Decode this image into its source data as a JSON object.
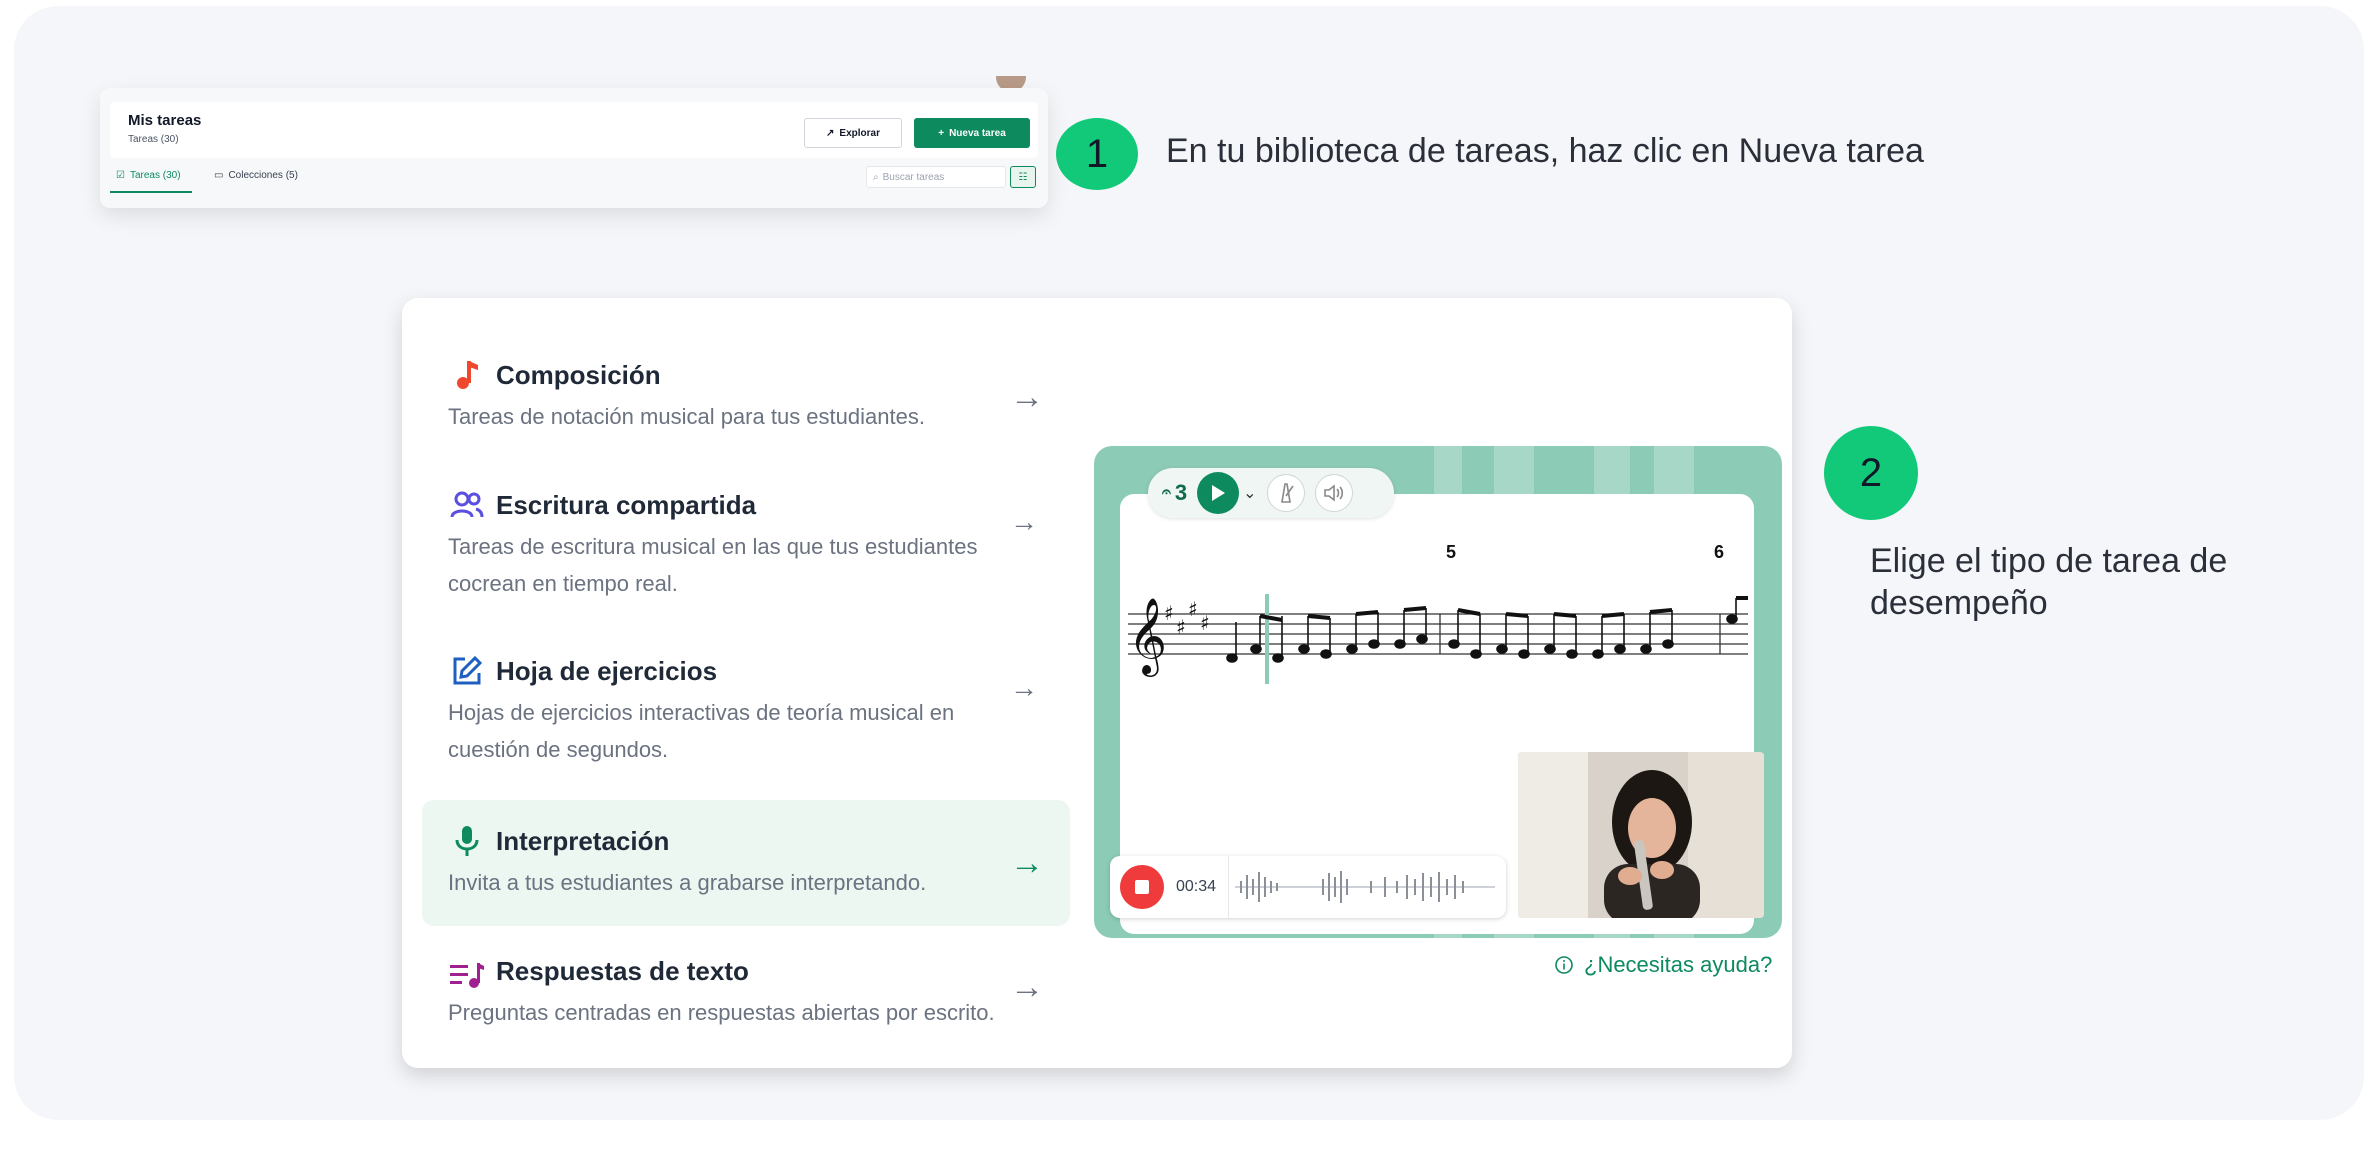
{
  "step1": {
    "number": "1",
    "text": "En tu biblioteca de tareas, haz clic en Nueva tarea",
    "panel": {
      "title": "Mis tareas",
      "subtitle": "Tareas (30)",
      "explore_label": "Explorar",
      "new_task_label": "Nueva tarea",
      "tabs": [
        {
          "label": "Tareas (30)",
          "active": true
        },
        {
          "label": "Colecciones (5)",
          "active": false
        }
      ],
      "search_placeholder": "Buscar tareas"
    }
  },
  "step2": {
    "number": "2",
    "text": "Elige el tipo de tarea de desempeño"
  },
  "options": [
    {
      "title": "Composición",
      "description": "Tareas de notación musical para tus estudiantes.",
      "icon": "music-note-icon",
      "color": "#f0482e"
    },
    {
      "title": "Escritura compartida",
      "description": "Tareas de escritura musical en las que tus estudiantes cocrean en tiempo real.",
      "icon": "users-icon",
      "color": "#5b4fe0"
    },
    {
      "title": "Hoja de ejercicios",
      "description": "Hojas de ejercicios interactivas de teoría musical en cuestión de segundos.",
      "icon": "edit-icon",
      "color": "#1f5fbf"
    },
    {
      "title": "Interpretación",
      "description": "Invita a tus estudiantes a grabarse interpretando.",
      "icon": "microphone-icon",
      "color": "#0e8a5f",
      "selected": true
    },
    {
      "title": "Respuestas de texto",
      "description": "Preguntas centradas en respuestas abiertas por escrito.",
      "icon": "text-music-icon",
      "color": "#a0208f"
    }
  ],
  "preview": {
    "count": "3",
    "measures": [
      "5",
      "6"
    ],
    "timer": "00:34"
  },
  "help_label": "¿Necesitas ayuda?",
  "colors": {
    "accent": "#0e8a5f",
    "badge": "#12c97a",
    "record": "#ef3b3b"
  }
}
